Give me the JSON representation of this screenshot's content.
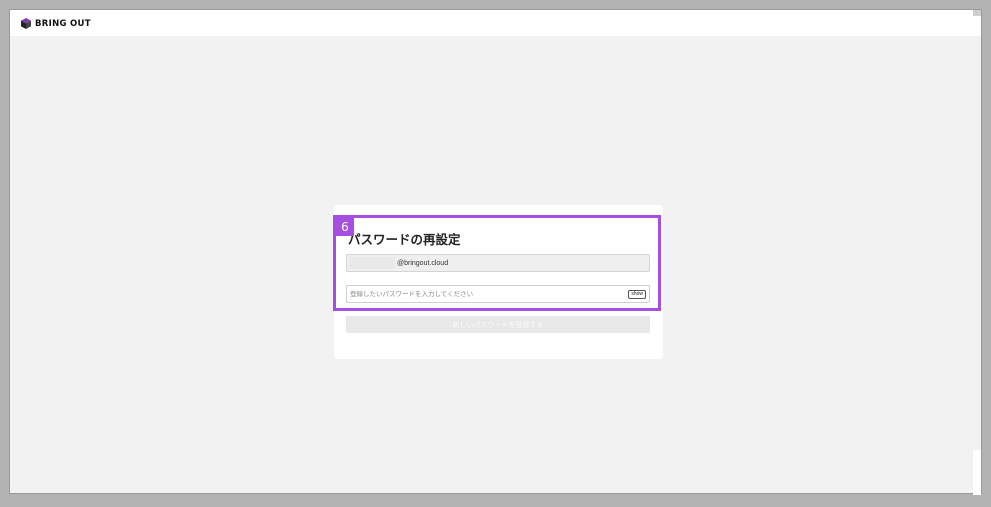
{
  "header": {
    "brand": "BRING OUT"
  },
  "form": {
    "title": "パスワードの再設定",
    "email_domain": "@bringout.cloud",
    "password_placeholder": "登録したいパスワードを入力してください",
    "show_label": "show",
    "submit_label": "新しいパスワードを登録する"
  },
  "annotation": {
    "badge": "6"
  },
  "colors": {
    "highlight": "#a64ee0",
    "page_background": "#f2f2f2"
  },
  "icons": {
    "logo": "cube-logo-icon"
  }
}
